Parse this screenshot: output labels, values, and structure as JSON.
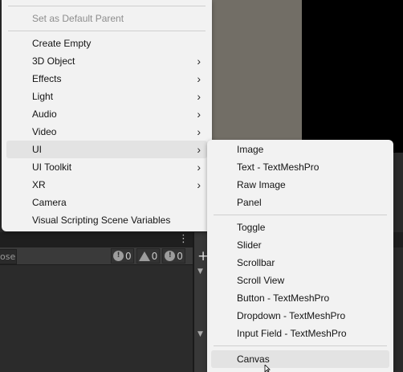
{
  "main_menu": {
    "items": [
      {
        "label": "Set as Default Parent",
        "disabled": true
      },
      {
        "label": "Create Empty"
      },
      {
        "label": "3D Object"
      },
      {
        "label": "Effects"
      },
      {
        "label": "Light"
      },
      {
        "label": "Audio"
      },
      {
        "label": "Video"
      },
      {
        "label": "UI"
      },
      {
        "label": "UI Toolkit"
      },
      {
        "label": "XR"
      },
      {
        "label": "Camera"
      },
      {
        "label": "Visual Scripting Scene Variables"
      }
    ],
    "submenu_arrow": "›"
  },
  "ui_submenu": {
    "items": [
      {
        "label": "Image"
      },
      {
        "label": "Text - TextMeshPro"
      },
      {
        "label": "Raw Image"
      },
      {
        "label": "Panel"
      },
      {
        "label": "Toggle"
      },
      {
        "label": "Slider"
      },
      {
        "label": "Scrollbar"
      },
      {
        "label": "Scroll View"
      },
      {
        "label": "Button - TextMeshPro"
      },
      {
        "label": "Dropdown - TextMeshPro"
      },
      {
        "label": "Input Field - TextMeshPro"
      },
      {
        "label": "Canvas"
      }
    ]
  },
  "editor": {
    "search_fragment": "ose",
    "console": {
      "info_count": "0",
      "warning_count": "0",
      "error_count": "0"
    }
  },
  "icons": {
    "kebab": "kebab-menu-icon",
    "folder": "folder-icon",
    "plus": "plus-icon",
    "info": "info-icon",
    "warning": "warning-icon",
    "error": "error-icon",
    "cursor": "mouse-cursor-icon"
  },
  "colors": {
    "menu_bg": "#f2f2f2",
    "menu_text": "#141414",
    "disabled_text": "#8d8d8d",
    "hover_bg": "#e3e3e3",
    "scene_bg": "#726e66",
    "editor_dark": "#2a2a2a"
  }
}
